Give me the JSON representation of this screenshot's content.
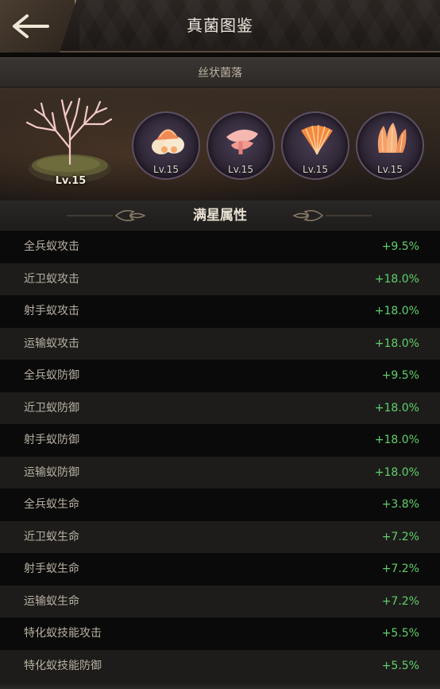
{
  "header": {
    "title": "真菌图鉴",
    "back_icon": "arrow-left-icon"
  },
  "category": {
    "label": "丝状菌落"
  },
  "showcase": {
    "main": {
      "level": "Lv.15",
      "icon": "coral-fungus-tree-icon"
    },
    "variants": [
      {
        "level": "Lv.15",
        "icon": "orange-coral-cluster-icon"
      },
      {
        "level": "Lv.15",
        "icon": "pink-oyster-fungus-icon"
      },
      {
        "level": "Lv.15",
        "icon": "fan-coral-fungus-icon"
      },
      {
        "level": "Lv.15",
        "icon": "tube-coral-fungus-icon"
      }
    ]
  },
  "section": {
    "title": "满星属性"
  },
  "attributes": [
    {
      "name": "全兵蚁攻击",
      "value": "+9.5%"
    },
    {
      "name": "近卫蚁攻击",
      "value": "+18.0%"
    },
    {
      "name": "射手蚁攻击",
      "value": "+18.0%"
    },
    {
      "name": "运输蚁攻击",
      "value": "+18.0%"
    },
    {
      "name": "全兵蚁防御",
      "value": "+9.5%"
    },
    {
      "name": "近卫蚁防御",
      "value": "+18.0%"
    },
    {
      "name": "射手蚁防御",
      "value": "+18.0%"
    },
    {
      "name": "运输蚁防御",
      "value": "+18.0%"
    },
    {
      "name": "全兵蚁生命",
      "value": "+3.8%"
    },
    {
      "name": "近卫蚁生命",
      "value": "+7.2%"
    },
    {
      "name": "射手蚁生命",
      "value": "+7.2%"
    },
    {
      "name": "运输蚁生命",
      "value": "+7.2%"
    },
    {
      "name": "特化蚁技能攻击",
      "value": "+5.5%"
    },
    {
      "name": "特化蚁技能防御",
      "value": "+5.5%"
    }
  ],
  "colors": {
    "value_green": "#5fd06a",
    "accent_gold": "#a88a5a"
  }
}
